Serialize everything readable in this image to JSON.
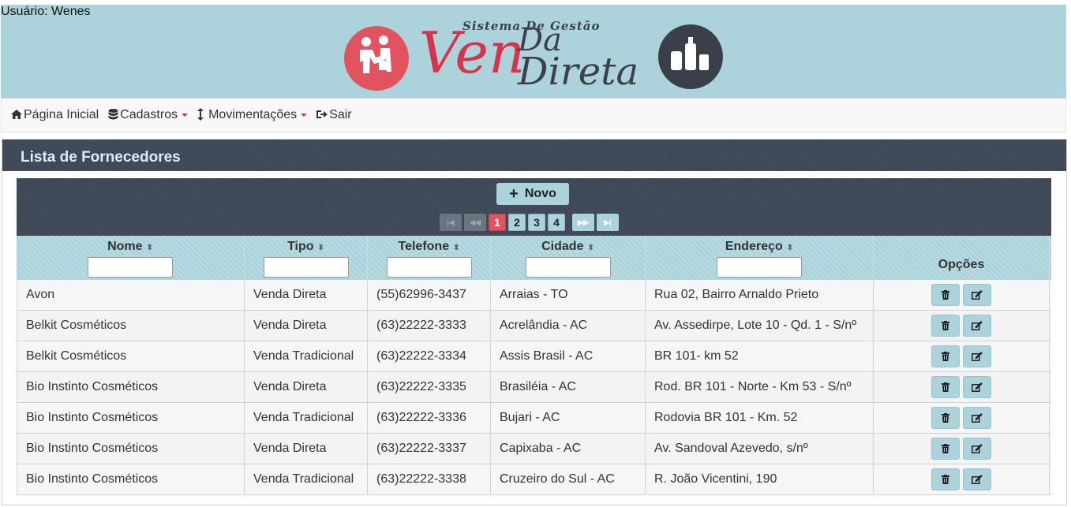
{
  "user": {
    "label": "Usuário: Wenes"
  },
  "logo": {
    "subtitle": "Sistema De Gestão",
    "ven": "Ven",
    "da": "Da",
    "direta": "Direta"
  },
  "nav": {
    "home": "Página Inicial",
    "cadastros": "Cadastros",
    "movimentacoes": "Movimentações",
    "sair": "Sair"
  },
  "panel": {
    "title": "Lista de Fornecedores"
  },
  "toolbar": {
    "new_label": "Novo"
  },
  "pager": {
    "pages": [
      "1",
      "2",
      "3",
      "4"
    ],
    "active": "1"
  },
  "columns": {
    "nome": "Nome",
    "tipo": "Tipo",
    "telefone": "Telefone",
    "cidade": "Cidade",
    "endereco": "Endereço",
    "opcoes": "Opções"
  },
  "rows": [
    {
      "nome": "Avon",
      "tipo": "Venda Direta",
      "telefone": "(55)62996-3437",
      "cidade": "Arraias - TO",
      "endereco": "Rua 02, Bairro Arnaldo Prieto"
    },
    {
      "nome": "Belkit Cosméticos",
      "tipo": "Venda Direta",
      "telefone": "(63)22222-3333",
      "cidade": "Acrelândia - AC",
      "endereco": "Av. Assedirpe, Lote 10 - Qd. 1 - S/nº"
    },
    {
      "nome": "Belkit Cosméticos",
      "tipo": "Venda Tradicional",
      "telefone": "(63)22222-3334",
      "cidade": "Assis Brasil - AC",
      "endereco": "BR 101- km 52"
    },
    {
      "nome": "Bio Instinto Cosméticos",
      "tipo": "Venda Direta",
      "telefone": "(63)22222-3335",
      "cidade": "Brasiléia - AC",
      "endereco": "Rod. BR 101 - Norte - Km 53 - S/nº"
    },
    {
      "nome": "Bio Instinto Cosméticos",
      "tipo": "Venda Tradicional",
      "telefone": "(63)22222-3336",
      "cidade": "Bujari - AC",
      "endereco": "Rodovia BR 101 - Km. 52"
    },
    {
      "nome": "Bio Instinto Cosméticos",
      "tipo": "Venda Direta",
      "telefone": "(63)22222-3337",
      "cidade": "Capixaba - AC",
      "endereco": "Av. Sandoval Azevedo, s/nº"
    },
    {
      "nome": "Bio Instinto Cosméticos",
      "tipo": "Venda Tradicional",
      "telefone": "(63)22222-3338",
      "cidade": "Cruzeiro do Sul - AC",
      "endereco": "R. João Vicentini, 190"
    }
  ],
  "colors": {
    "banner": "#acd3dc",
    "dark": "#3b4553",
    "accent": "#e1535f"
  },
  "icons": [
    "home-icon",
    "database-icon",
    "vertical-arrows-icon",
    "sign-out-icon",
    "plus-icon",
    "trash-icon",
    "edit-icon",
    "sort-icon"
  ]
}
